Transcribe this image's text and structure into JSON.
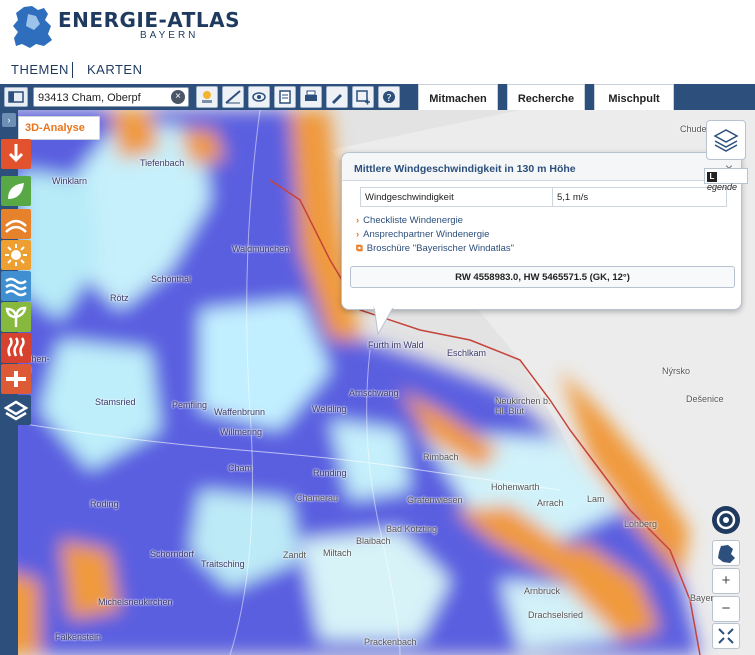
{
  "header": {
    "title": "ENERGIE-ATLAS",
    "subtitle": "BAYERN"
  },
  "nav": {
    "themes": "THEMEN",
    "maps": "KARTEN"
  },
  "toolbar": {
    "search_value": "93413 Cham, Oberpf",
    "tabs": [
      "Mitmachen",
      "Recherche",
      "Mischpult"
    ]
  },
  "sidebar": {
    "analysis_label": "3D-Analyse"
  },
  "popup": {
    "title": "Mittlere Windgeschwindigkeit in 130 m Höhe",
    "key": "Windgeschwindigkeit",
    "value": "5,1 m/s",
    "links": [
      "Checkliste Windenergie",
      "Ansprechpartner Windenergie",
      "Broschüre \"Bayerischer Windatlas\""
    ],
    "coords": "RW 4558983.0, HW 5465571.5 (GK, 12°)"
  },
  "legend_label": "egende",
  "legend_initial": "L",
  "places": [
    "Tiefenbach",
    "Winklarn",
    "Waldmünchen",
    "Schönthal",
    "Rötz",
    "Furth im Wald",
    "Eschlkam",
    "Stamsried",
    "Pemfling",
    "Waffenbrunn",
    "Willmering",
    "Arnschwang",
    "Weldling",
    "Neukirchen b. Hl. Blut",
    "Cham",
    "Runding",
    "Rimbach",
    "Hohenwarth",
    "Chamerau",
    "Grafenwiesen",
    "Arrach",
    "Lam",
    "Roding",
    "Bad Kötzting",
    "Blaibach",
    "Miltach",
    "Zandt",
    "Schorndorf",
    "Traitsching",
    "Lohberg",
    "Michelsneukirchen",
    "Arnbruck",
    "Drachselsried",
    "Falkenstein",
    "Prackenbach",
    "Chudenice",
    "Nýrsko",
    "Dešenice",
    "irchen-",
    "lbi",
    "Bayer"
  ],
  "colors": {
    "accent": "#e8761e",
    "brand": "#1f3a5f",
    "toolbar": "#2c4f7c"
  }
}
